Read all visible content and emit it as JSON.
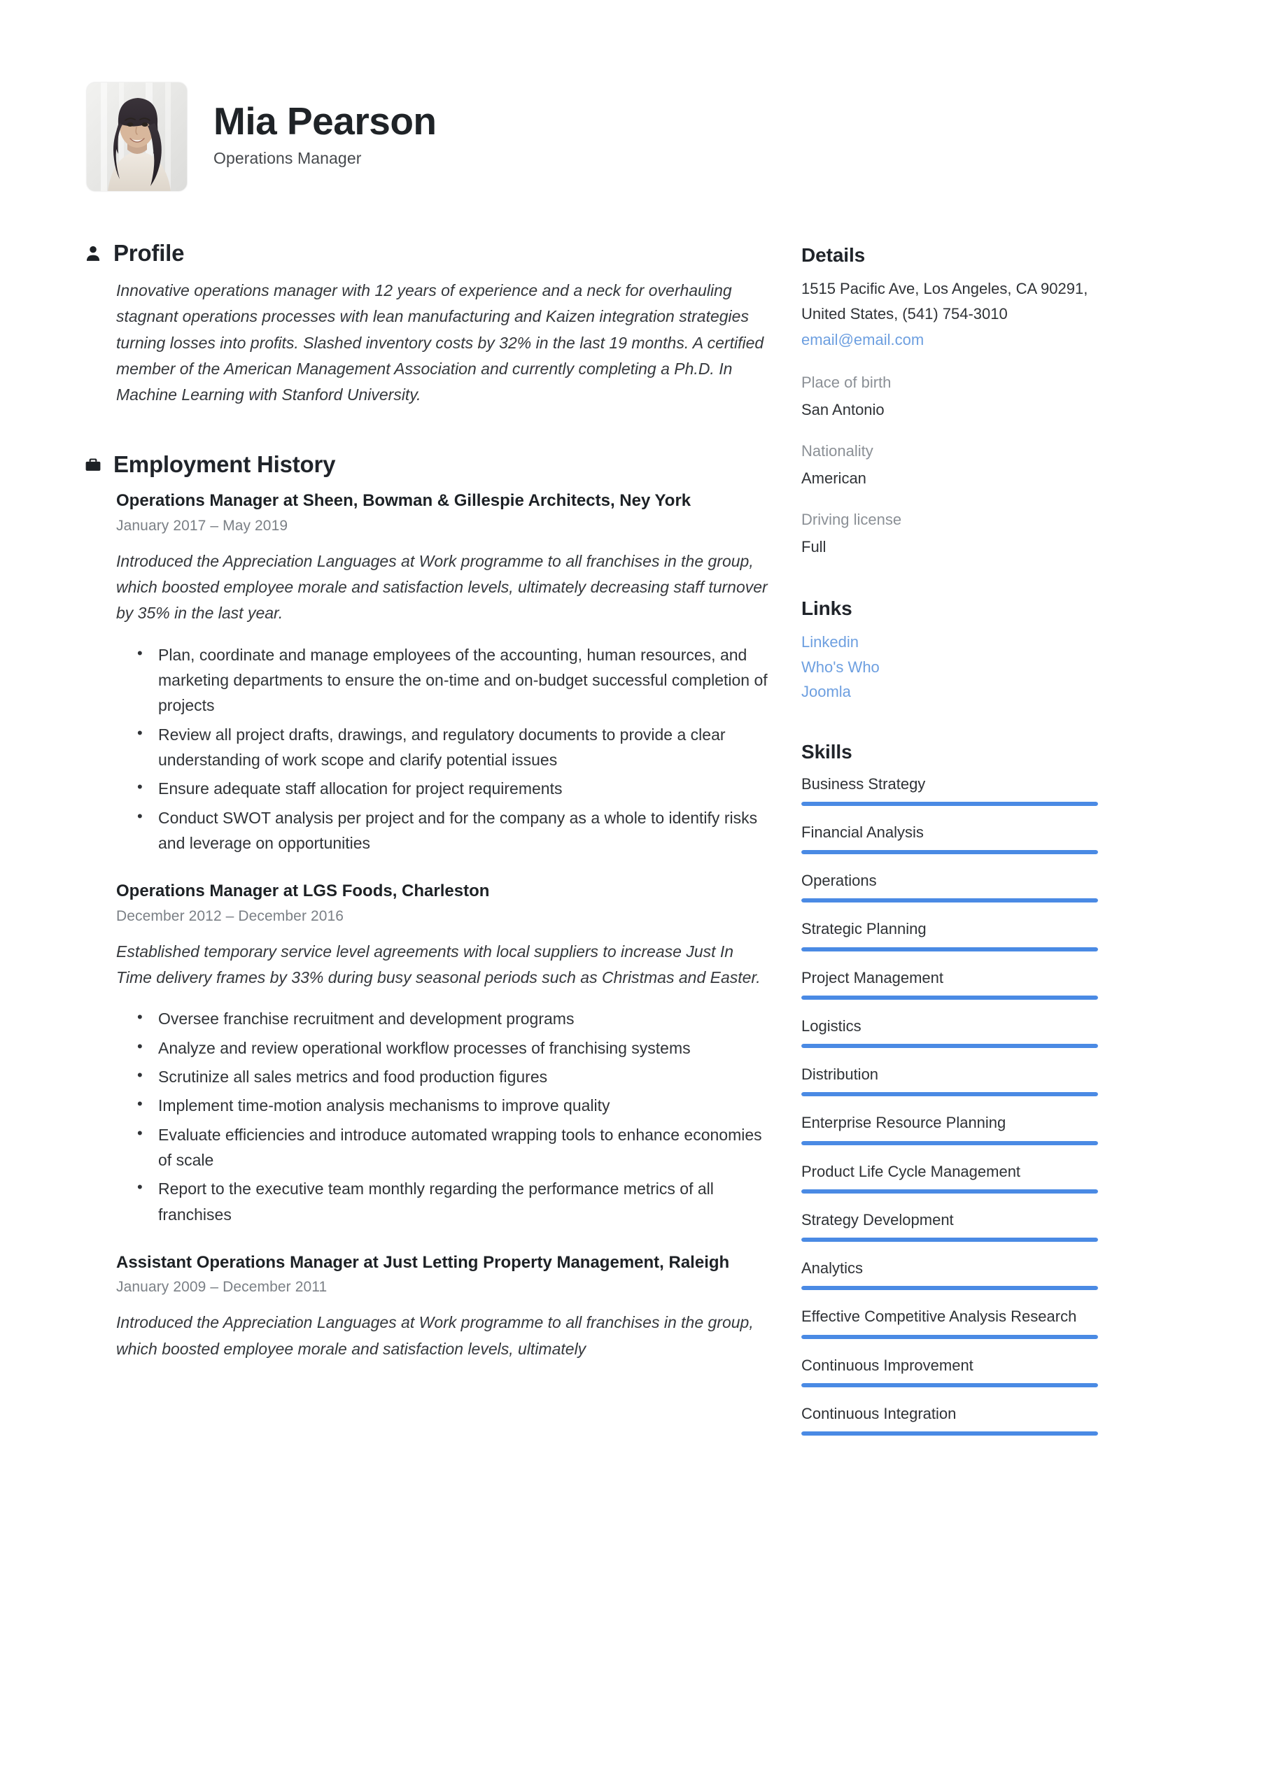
{
  "header": {
    "name": "Mia Pearson",
    "job_title": "Operations Manager",
    "photo_alt": "portrait-photo"
  },
  "main": {
    "profile": {
      "heading": "Profile",
      "icon": "person-icon",
      "text": "Innovative operations manager with 12 years of experience and a neck for overhauling stagnant operations processes with lean manufacturing and Kaizen integration strategies turning losses into profits. Slashed inventory costs by 32% in the last 19 months. A certified member of the American Management Association and currently completing a Ph.D. In Machine Learning with Stanford University."
    },
    "employment": {
      "heading": "Employment History",
      "icon": "briefcase-icon",
      "jobs": [
        {
          "title": "Operations Manager at Sheen, Bowman & Gillespie Architects, Ney York",
          "dates": "January 2017  –  May 2019",
          "summary": "Introduced the Appreciation Languages at Work programme to all franchises in the group, which boosted employee morale and satisfaction levels, ultimately decreasing staff turnover by 35% in the last year.",
          "bullets": [
            "Plan, coordinate and manage employees of the accounting, human resources, and marketing departments to ensure the on-time and on-budget successful completion of projects",
            "Review all project drafts, drawings, and regulatory documents to provide a clear understanding of work scope and clarify potential issues",
            "Ensure adequate staff allocation for project requirements",
            "Conduct SWOT analysis per project and for the company as a whole to identify risks and leverage on opportunities"
          ]
        },
        {
          "title": "Operations Manager at LGS Foods, Charleston",
          "dates": "December 2012  –  December 2016",
          "summary": "Established temporary service level agreements with local suppliers to increase Just In Time delivery frames by 33% during busy seasonal periods such as Christmas and Easter.",
          "bullets": [
            "Oversee franchise recruitment and development programs",
            "Analyze and review operational workflow processes of franchising systems",
            "Scrutinize all sales metrics and food production figures",
            "Implement time-motion analysis mechanisms to improve quality",
            "Evaluate efficiencies and introduce automated wrapping tools to enhance economies of scale",
            "Report to the executive team monthly regarding the performance metrics of all franchises"
          ]
        },
        {
          "title": "Assistant Operations Manager at Just Letting Property Management, Raleigh",
          "dates": "January 2009  –  December 2011",
          "summary": "Introduced the Appreciation Languages at Work programme to all franchises in the group, which boosted employee morale and satisfaction levels, ultimately",
          "bullets": []
        }
      ]
    }
  },
  "sidebar": {
    "details": {
      "heading": "Details",
      "address": "1515 Pacific Ave, Los Angeles, CA 90291, United States, (541) 754-3010",
      "email": "email@email.com",
      "fields": [
        {
          "label": "Place of birth",
          "value": "San Antonio"
        },
        {
          "label": "Nationality",
          "value": "American"
        },
        {
          "label": "Driving license",
          "value": "Full"
        }
      ]
    },
    "links": {
      "heading": "Links",
      "items": [
        "Linkedin",
        "Who's Who",
        "Joomla"
      ]
    },
    "skills": {
      "heading": "Skills",
      "items": [
        {
          "name": "Business Strategy",
          "level": 100
        },
        {
          "name": "Financial Analysis",
          "level": 100
        },
        {
          "name": "Operations",
          "level": 100
        },
        {
          "name": "Strategic Planning",
          "level": 100
        },
        {
          "name": "Project Management",
          "level": 100
        },
        {
          "name": "Logistics",
          "level": 100
        },
        {
          "name": "Distribution",
          "level": 100
        },
        {
          "name": "Enterprise Resource Planning",
          "level": 100
        },
        {
          "name": "Product Life Cycle Management",
          "level": 100
        },
        {
          "name": "Strategy Development",
          "level": 100
        },
        {
          "name": "Analytics",
          "level": 100
        },
        {
          "name": "Effective Competitive Analysis Research",
          "level": 100
        },
        {
          "name": "Continuous Improvement",
          "level": 100
        },
        {
          "name": "Continuous Integration",
          "level": 100
        }
      ]
    }
  },
  "colors": {
    "accent": "#4a8ae4",
    "link": "#6d9fe0",
    "text": "#2f3236",
    "muted": "#8b9096"
  }
}
